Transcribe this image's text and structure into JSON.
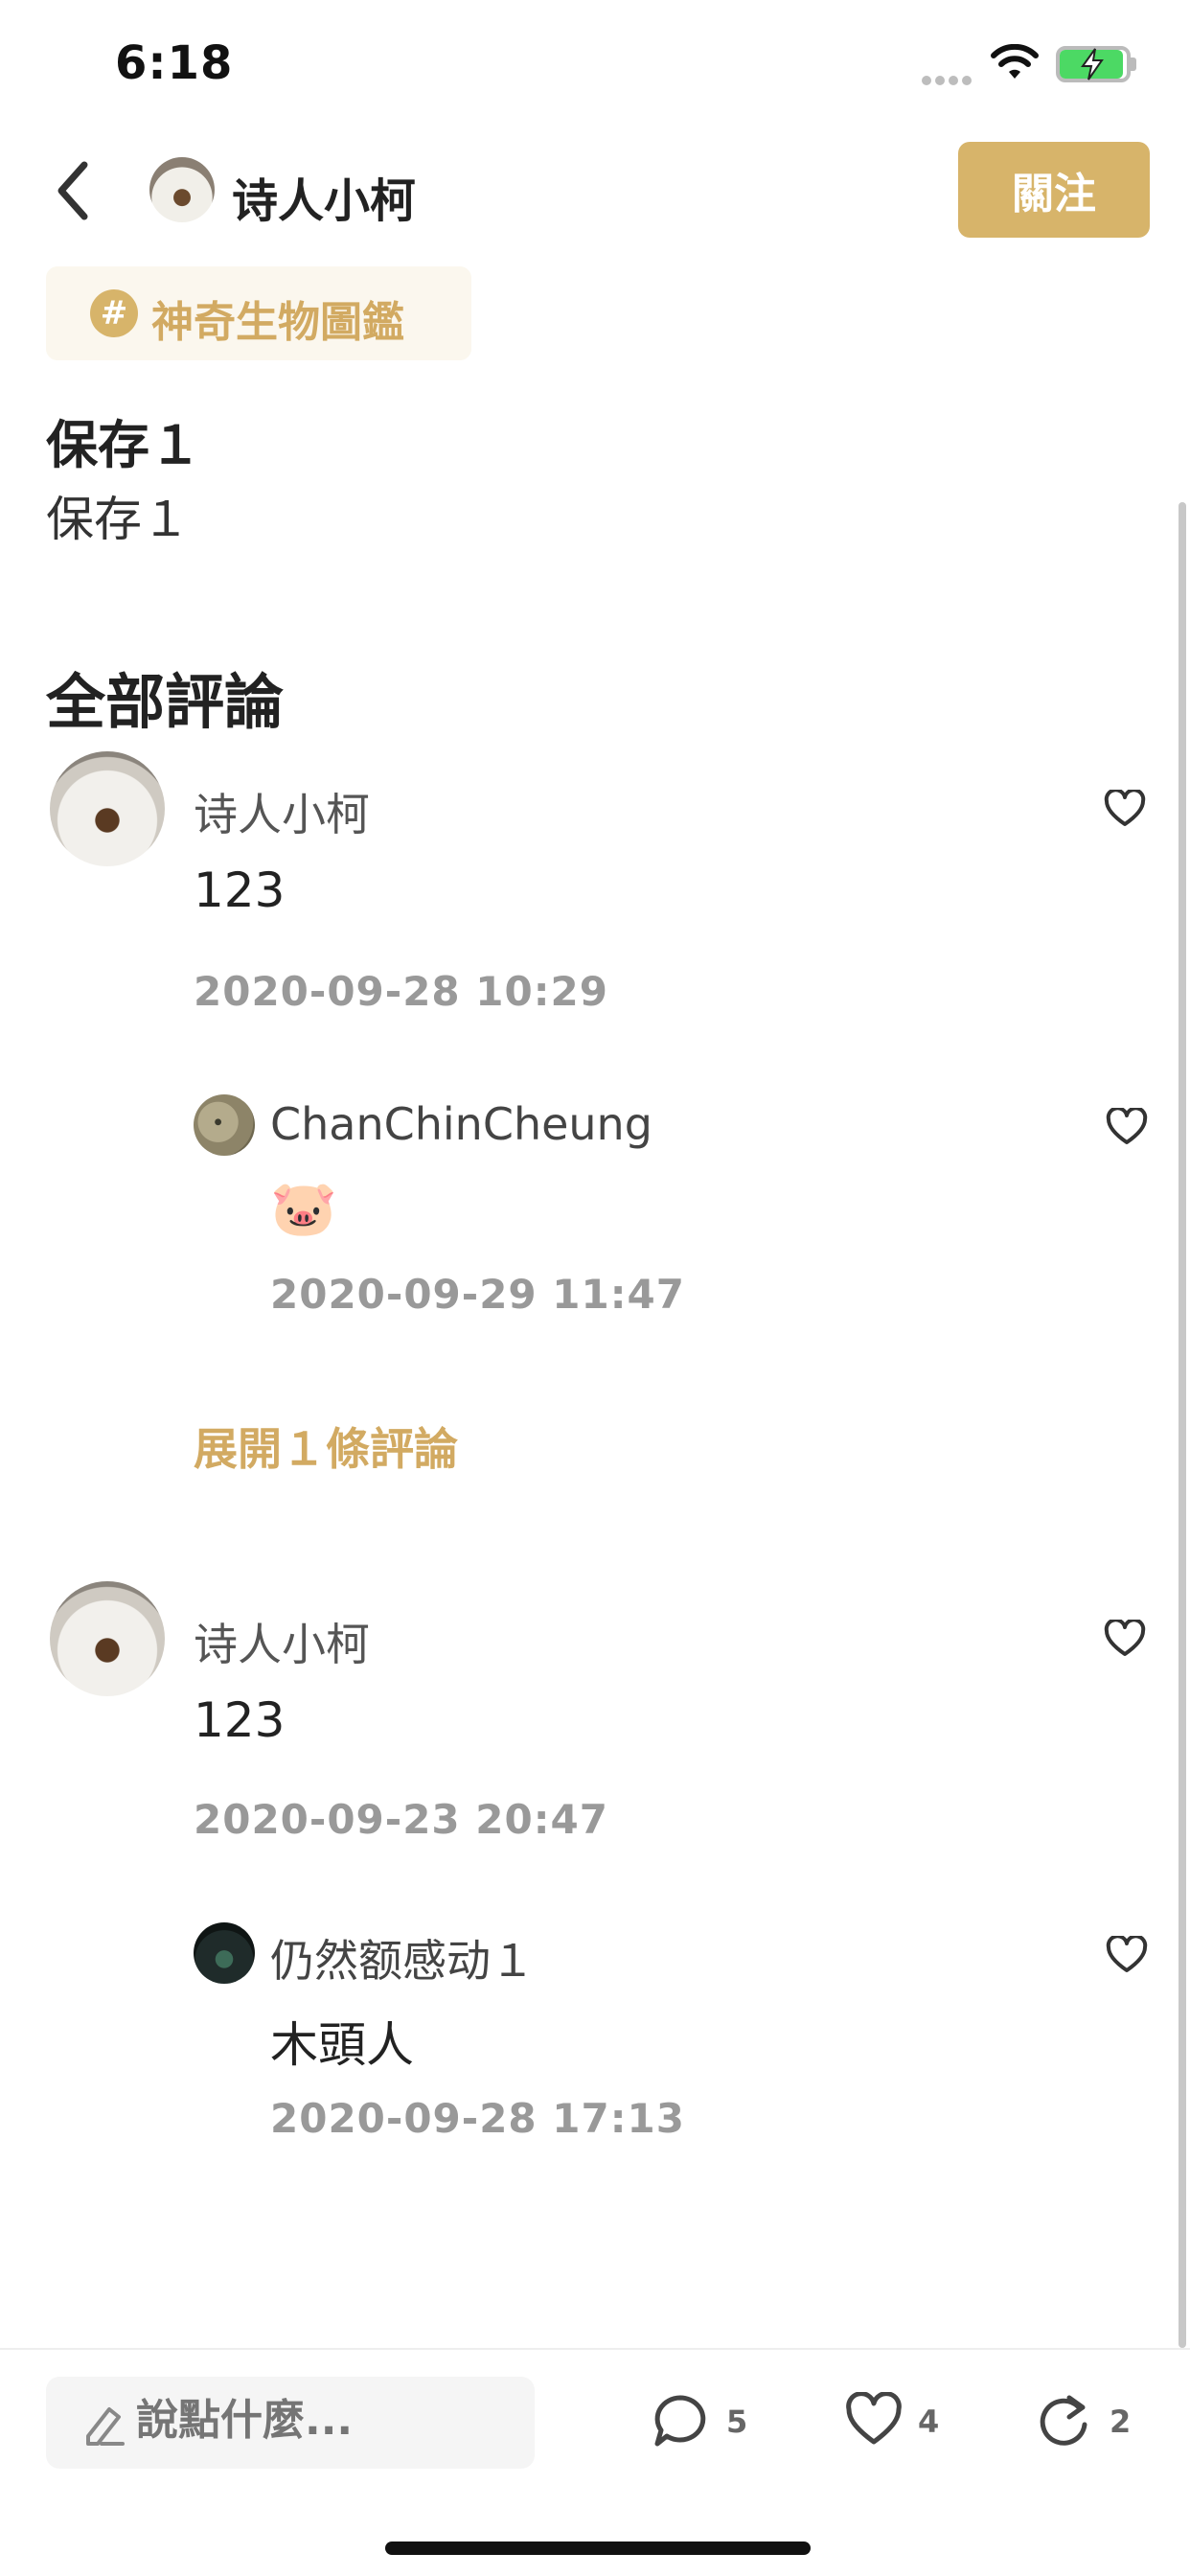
{
  "status_bar": {
    "time": "6:18"
  },
  "header": {
    "author_name": "诗人小柯",
    "follow_label": "關注"
  },
  "tag": {
    "symbol": "#",
    "label": "神奇生物圖鑑"
  },
  "post": {
    "title": "保存１",
    "body": "保存１"
  },
  "comments_section": {
    "title": "全部評論"
  },
  "comments": [
    {
      "name": "诗人小柯",
      "text": "123",
      "time": "2020-09-28 10:29",
      "reply": {
        "name": "ChanChinCheung",
        "text": "🐷",
        "time": "2020-09-29 11:47"
      },
      "expand_label": "展開１條評論"
    },
    {
      "name": "诗人小柯",
      "text": "123",
      "time": "2020-09-23 20:47",
      "reply": {
        "name": "仍然额感动１",
        "text": "木頭人",
        "time": "2020-09-28 17:13"
      }
    }
  ],
  "bottom_bar": {
    "input_placeholder": "說點什麼...",
    "comment_count": "5",
    "like_count": "4",
    "share_count": "2"
  },
  "colors": {
    "accent": "#d7b46a",
    "accent_text": "#d2aa62",
    "tag_bg": "#fbf7ee"
  },
  "icons": [
    "back-chevron-icon",
    "hash-icon",
    "heart-icon",
    "pencil-icon",
    "comment-bubble-icon",
    "share-icon",
    "wifi-icon",
    "battery-icon"
  ]
}
